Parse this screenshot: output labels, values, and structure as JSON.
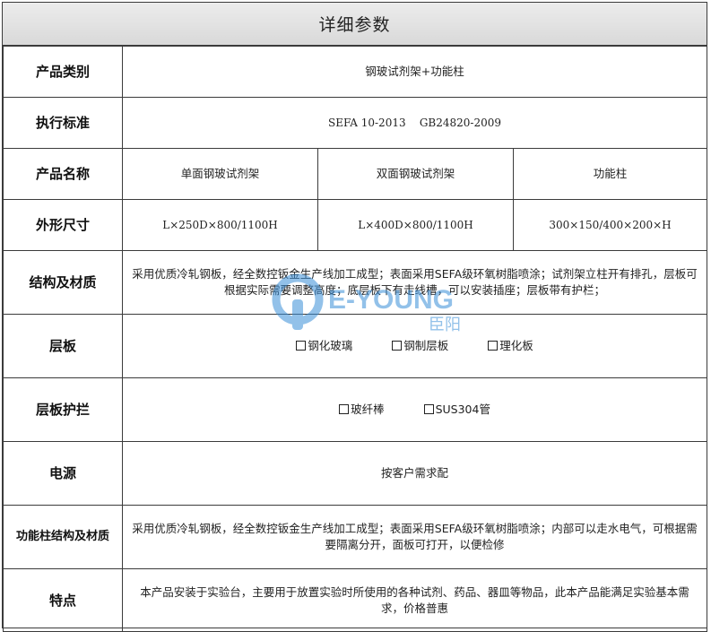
{
  "title": "详细参数",
  "rows": {
    "category": {
      "label": "产品类别",
      "value": "钢玻试剂架+功能柱"
    },
    "standard": {
      "label": "执行标准",
      "value": "SEFA 10-2013    GB24820-2009"
    },
    "names": {
      "label": "产品名称",
      "cols": [
        "单面钢玻试剂架",
        "双面钢玻试剂架",
        "功能柱"
      ]
    },
    "size": {
      "label": "外形尺寸",
      "cols": [
        "L×250D×800/1100H",
        "L×400D×800/1100H",
        "300×150/400×200×H"
      ]
    },
    "material": {
      "label": "结构及材质",
      "value": "采用优质冷轧钢板，经全数控钣金生产线加工成型；表面采用SEFA级环氧树脂喷涂；试剂架立柱开有排孔，层板可根据实际需要调整高度；底层板下有走线槽，可以安装插座；层板带有护栏；"
    },
    "shelf": {
      "label": "层板",
      "options": [
        "钢化玻璃",
        "钢制层板",
        "理化板"
      ]
    },
    "guard": {
      "label": "层板护拦",
      "options": [
        "玻纤棒",
        "SUS304管"
      ]
    },
    "power": {
      "label": "电源",
      "value": "按客户需求配"
    },
    "column_material": {
      "label": "功能柱结构及材质",
      "value": "采用优质冷轧钢板，经全数控钣金生产线加工成型；表面采用SEFA级环氧树脂喷涂；内部可以走水电气，可根据需要隔离分开，面板可打开，以便检修"
    },
    "features": {
      "label": "特点",
      "value": "本产品安装于实验台，主要用于放置实验时所使用的各种试剂、药品、器皿等物品，此本产品能满足实验基本需求，价格普惠"
    }
  },
  "watermark": {
    "brand": "E-YOUNG",
    "cn": "臣阳",
    "color": "#3a8fd8"
  }
}
